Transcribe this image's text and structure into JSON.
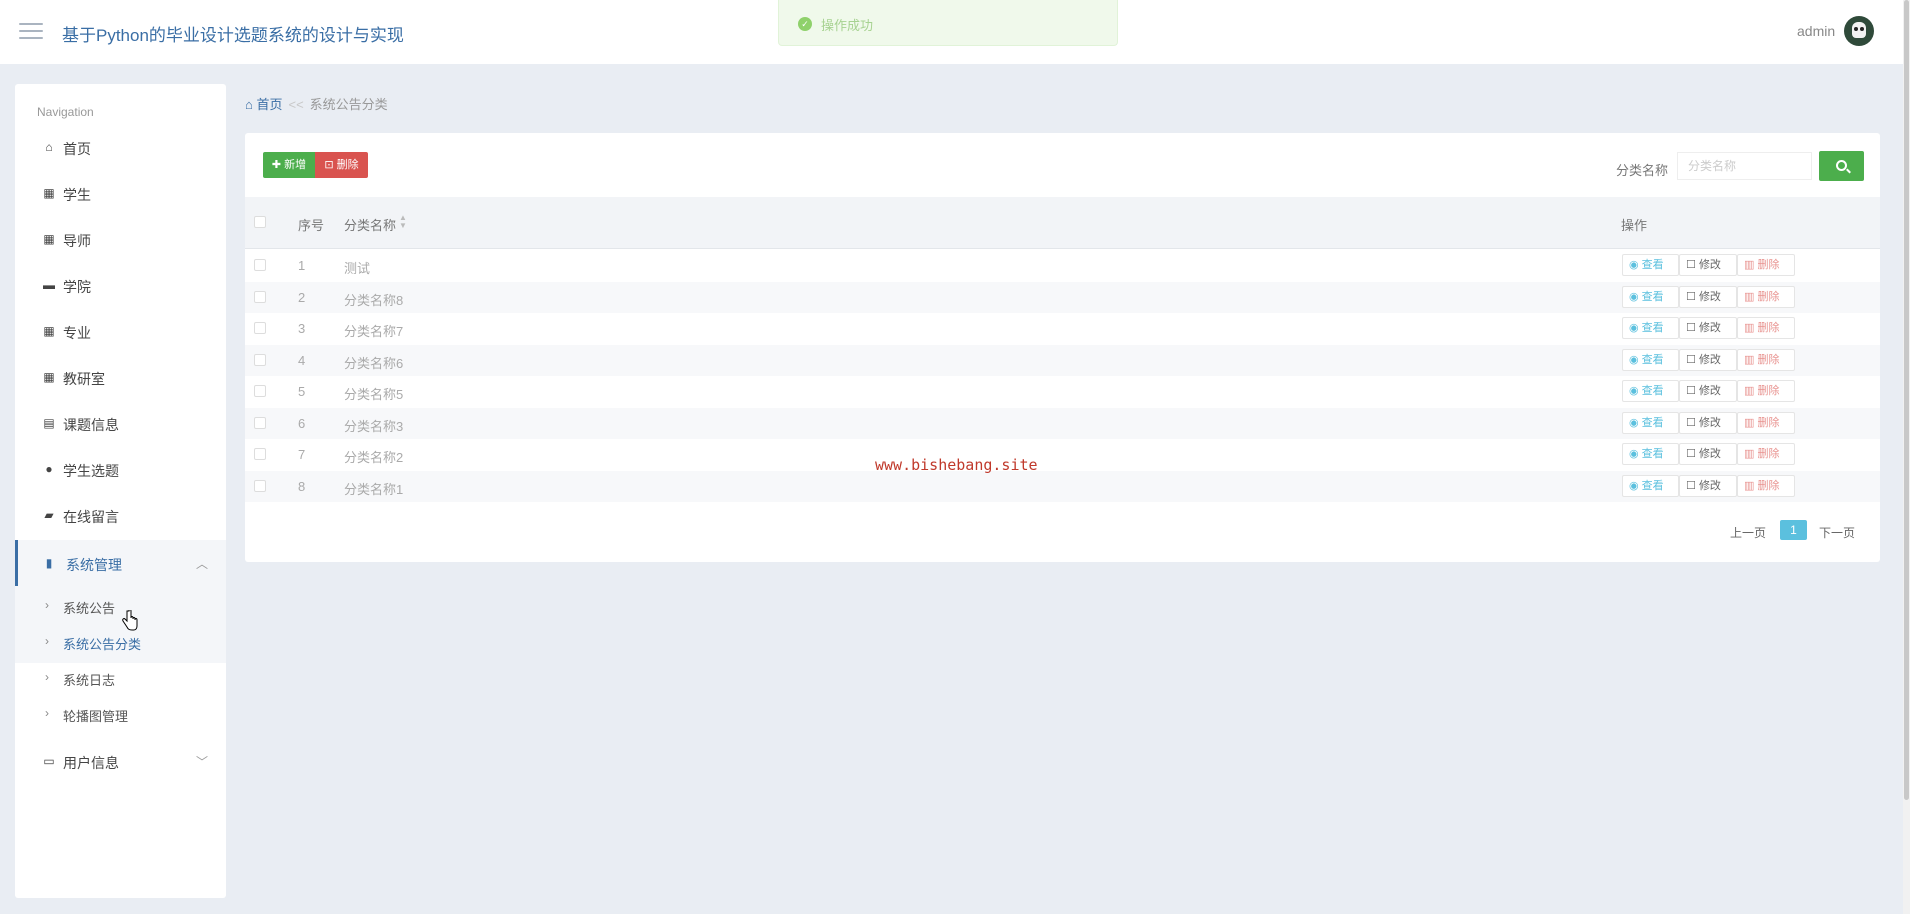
{
  "header": {
    "title": "基于Python的毕业设计选题系统的设计与实现",
    "toast": "操作成功",
    "user": "admin"
  },
  "sidebar": {
    "nav_title": "Navigation",
    "items": [
      {
        "label": "首页",
        "icon": "home-icon"
      },
      {
        "label": "学生",
        "icon": "grid-icon"
      },
      {
        "label": "导师",
        "icon": "grid-icon"
      },
      {
        "label": "学院",
        "icon": "briefcase-icon"
      },
      {
        "label": "专业",
        "icon": "grid-icon"
      },
      {
        "label": "教研室",
        "icon": "grid-icon"
      },
      {
        "label": "课题信息",
        "icon": "clipboard-icon"
      },
      {
        "label": "学生选题",
        "icon": "user-icon"
      },
      {
        "label": "在线留言",
        "icon": "ticket-icon"
      },
      {
        "label": "系统管理",
        "icon": "bar-chart-icon"
      }
    ],
    "sub_items": [
      {
        "label": "系统公告"
      },
      {
        "label": "系统公告分类"
      },
      {
        "label": "系统日志"
      },
      {
        "label": "轮播图管理"
      }
    ],
    "user_info": {
      "label": "用户信息",
      "icon": "card-icon"
    }
  },
  "breadcrumb": {
    "home": "首页",
    "separator": "<<",
    "current": "系统公告分类"
  },
  "toolbar": {
    "add_label": "新增",
    "delete_label": "删除",
    "search_label": "分类名称",
    "search_placeholder": "分类名称"
  },
  "table": {
    "columns": [
      "序号",
      "分类名称",
      "操作"
    ],
    "rows": [
      {
        "num": "1",
        "name": "测试"
      },
      {
        "num": "2",
        "name": "分类名称8"
      },
      {
        "num": "3",
        "name": "分类名称7"
      },
      {
        "num": "4",
        "name": "分类名称6"
      },
      {
        "num": "5",
        "name": "分类名称5"
      },
      {
        "num": "6",
        "name": "分类名称3"
      },
      {
        "num": "7",
        "name": "分类名称2"
      },
      {
        "num": "8",
        "name": "分类名称1"
      }
    ],
    "actions": {
      "view": "查看",
      "edit": "修改",
      "delete": "删除"
    }
  },
  "pagination": {
    "prev": "上一页",
    "current": "1",
    "next": "下一页"
  },
  "watermark": "www.bishebang.site",
  "colors": {
    "primary": "#3a6ea5",
    "success": "#4cae4c",
    "danger": "#d9534f",
    "info": "#5bc0de"
  }
}
